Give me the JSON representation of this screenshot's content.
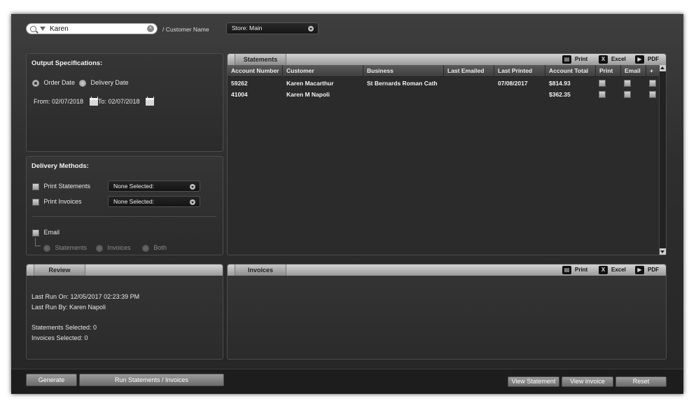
{
  "search": {
    "value": "Karen",
    "label": "/ Customer Name"
  },
  "store": {
    "selected": "Store: Main"
  },
  "output": {
    "title": "Output Specifications:",
    "order_date": "Order Date",
    "delivery_date": "Delivery Date",
    "from": "From: 02/07/2018",
    "to": "To: 02/07/2018"
  },
  "delivery": {
    "title": "Delivery Methods:",
    "print_statements": "Print Statements",
    "print_invoices": "Print Invoices",
    "statements_select": "None Selected:",
    "invoices_select": "None Selected:",
    "email": "Email",
    "email_statements": "Statements",
    "email_invoices": "Invoices",
    "email_both": "Both"
  },
  "statements": {
    "tab": "Statements",
    "tools": {
      "print": "Print",
      "excel": "Excel",
      "pdf": "PDF"
    },
    "columns": [
      "Account Number",
      "Customer",
      "Business",
      "Last Emailed",
      "Last Printed",
      "Account Total",
      "Print",
      "Email",
      "+"
    ],
    "rows": [
      {
        "account": "59262",
        "customer": "Karen Macarthur",
        "business": "St Bernards Roman Cath",
        "last_emailed": "",
        "last_printed": "07/08/2017",
        "total": "$814.93"
      },
      {
        "account": "41004",
        "customer": "Karen M Napoli",
        "business": "",
        "last_emailed": "",
        "last_printed": "",
        "total": "$362.35"
      }
    ]
  },
  "review": {
    "tab": "Review",
    "last_run_on": "Last Run On: 12/05/2017  02:23:39 PM",
    "last_run_by": "Last Run By: Karen Napoli",
    "statements_selected": "Statements Selected: 0",
    "invoices_selected": "Invoices Selected: 0"
  },
  "invoices": {
    "tab": "Invoices",
    "tools": {
      "print": "Print",
      "excel": "Excel",
      "pdf": "PDF"
    }
  },
  "buttons": {
    "generate": "Generate",
    "run": "Run Statements / Invoices",
    "view_statement": "View Statement",
    "view_invoice": "View invoice",
    "reset": "Reset"
  },
  "icons": {
    "search": "search-icon",
    "filter": "filter-icon",
    "clear": "clear-icon",
    "calendar": "calendar-icon",
    "printer": "printer-icon",
    "excel": "excel-icon",
    "pdf": "pdf-icon"
  },
  "colors": {
    "background": "#2e2e2e",
    "header": "#c8c8c8",
    "text": "#e8e8e8"
  }
}
